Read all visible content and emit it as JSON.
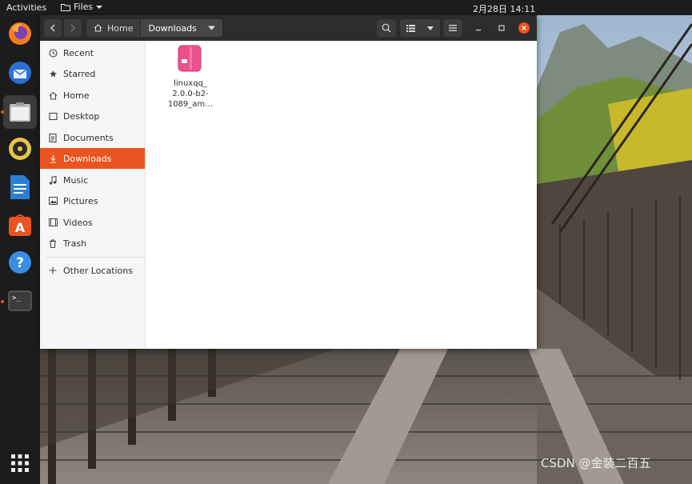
{
  "topbar": {
    "activities": "Activities",
    "app_name": "Files",
    "clock": "2月28日  14:11"
  },
  "dock": {
    "items": [
      {
        "name": "firefox-icon"
      },
      {
        "name": "thunderbird-icon"
      },
      {
        "name": "files-icon"
      },
      {
        "name": "rhythmbox-icon"
      },
      {
        "name": "writer-icon"
      },
      {
        "name": "software-center-icon"
      },
      {
        "name": "help-icon"
      },
      {
        "name": "terminal-icon"
      },
      {
        "name": "show-apps-icon"
      }
    ]
  },
  "breadcrumb": {
    "home": "Home",
    "current": "Downloads"
  },
  "sidebar": {
    "items": [
      {
        "label": "Recent",
        "icon": "clock-icon"
      },
      {
        "label": "Starred",
        "icon": "star-icon"
      },
      {
        "label": "Home",
        "icon": "home-icon"
      },
      {
        "label": "Desktop",
        "icon": "desktop-icon"
      },
      {
        "label": "Documents",
        "icon": "documents-icon"
      },
      {
        "label": "Downloads",
        "icon": "download-icon",
        "selected": true
      },
      {
        "label": "Music",
        "icon": "music-icon"
      },
      {
        "label": "Pictures",
        "icon": "pictures-icon"
      },
      {
        "label": "Videos",
        "icon": "videos-icon"
      },
      {
        "label": "Trash",
        "icon": "trash-icon"
      }
    ],
    "other_locations": "Other Locations"
  },
  "files": [
    {
      "line1": "linuxqq_",
      "line2": "2.0.0-b2-",
      "line3": "1089_am…",
      "icon": "package-icon"
    }
  ],
  "watermark": "CSDN @金装二百五",
  "colors": {
    "accent": "#e95420",
    "headerbar": "#2c2c2c",
    "dock": "#1c1c1c"
  }
}
